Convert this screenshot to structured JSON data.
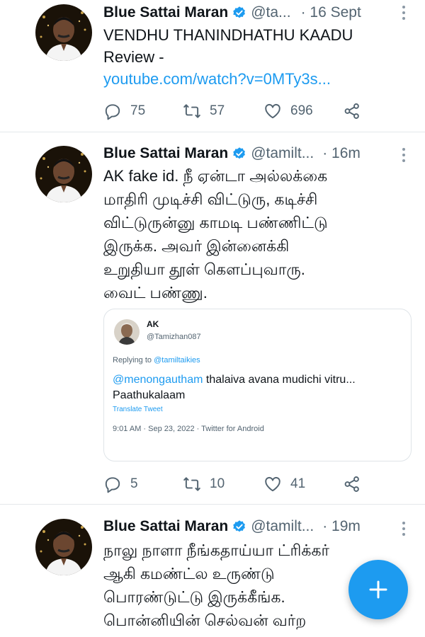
{
  "tweets": [
    {
      "name": "Blue Sattai Maran",
      "handle": "@ta...",
      "time": "· 16 Sept",
      "text_line1": "VENDHU THANINDHATHU KAADU",
      "text_line2": "Review -",
      "link": "youtube.com/watch?v=0MTy3s...",
      "replies": "75",
      "retweets": "57",
      "likes": "696"
    },
    {
      "name": "Blue Sattai Maran",
      "handle": "@tamilt...",
      "time": "· 16m",
      "text_lines": [
        "AK fake id. நீ ஏன்டா அல்லக்கை",
        "மாதிரி முடிச்சி விட்டுரு, கடிச்சி",
        "விட்டுருன்னு காமடி பண்ணிட்டு",
        "இருக்க. அவர் இன்னைக்கி",
        "உறுதியா தூள் கௌப்புவாரு.",
        "வைட் பண்ணு."
      ],
      "quote": {
        "name": "AK",
        "handle": "@Tamizhan087",
        "replying_prefix": "Replying to",
        "replying_handle": "@tamiltaikies",
        "mention": "@menongautham",
        "text_rest": "thalaiva avana mudichi vitru...",
        "text_line2": "Paathukalaam",
        "translate": "Translate Tweet",
        "meta": "9:01 AM · Sep 23, 2022 · Twitter for Android"
      },
      "replies": "5",
      "retweets": "10",
      "likes": "41"
    },
    {
      "name": "Blue Sattai Maran",
      "handle": "@tamilt...",
      "time": "· 19m",
      "text_lines": [
        "நாலு நாளா நீங்கதாய்யா ட்ரிக்கர்",
        "ஆகி கமண்ட்ல உருண்டு",
        "பொரண்டுட்டு இருக்கீங்க.",
        "பொன்னியின் செல்வன் வர்ற"
      ]
    }
  ],
  "fab": {
    "icon": "plus-icon"
  },
  "colors": {
    "accent": "#1d9bf0",
    "muted": "#536471",
    "verified": "#1d9bf0"
  }
}
